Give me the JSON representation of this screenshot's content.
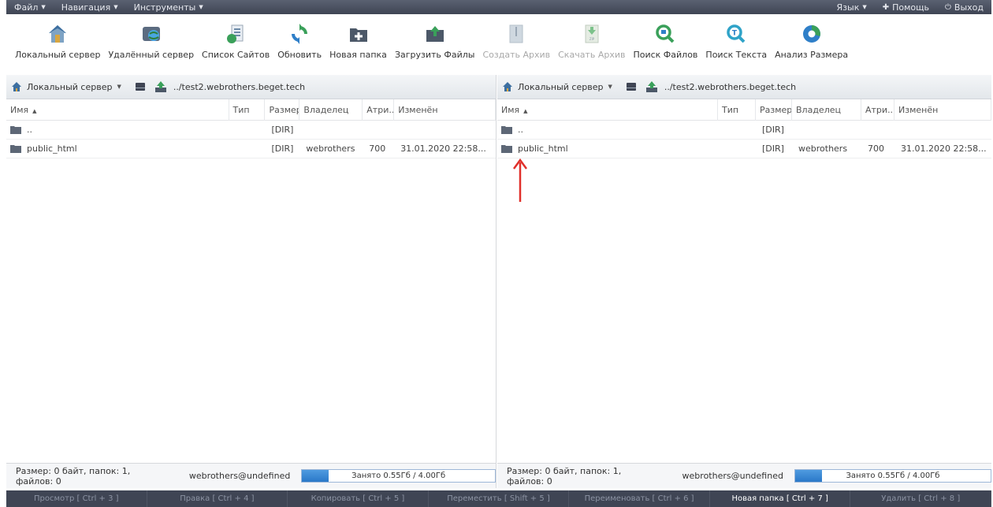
{
  "menubar": {
    "file": "Файл",
    "navigation": "Навигация",
    "tools": "Инструменты",
    "language": "Язык",
    "help": "Помощь",
    "logout": "Выход"
  },
  "toolbar": {
    "items": [
      {
        "label": "Локальный сервер",
        "icon": "home-icon",
        "enabled": true
      },
      {
        "label": "Удалённый сервер",
        "icon": "remote-server-icon",
        "enabled": true
      },
      {
        "label": "Список Сайтов",
        "icon": "site-list-icon",
        "enabled": true
      },
      {
        "label": "Обновить",
        "icon": "refresh-icon",
        "enabled": true
      },
      {
        "label": "Новая папка",
        "icon": "new-folder-icon",
        "enabled": true
      },
      {
        "label": "Загрузить Файлы",
        "icon": "upload-icon",
        "enabled": true
      },
      {
        "label": "Создать Архив",
        "icon": "archive-icon",
        "enabled": false
      },
      {
        "label": "Скачать Архив",
        "icon": "download-zip-icon",
        "enabled": false
      },
      {
        "label": "Поиск Файлов",
        "icon": "search-files-icon",
        "enabled": true
      },
      {
        "label": "Поиск Текста",
        "icon": "search-text-icon",
        "enabled": true
      },
      {
        "label": "Анализ Размера",
        "icon": "size-analysis-icon",
        "enabled": true
      }
    ]
  },
  "columns": {
    "name": "Имя",
    "type": "Тип",
    "size": "Размер",
    "owner": "Владелец",
    "attr": "Атри...",
    "modified": "Изменён"
  },
  "left_panel": {
    "server": "Локальный сервер",
    "path": "../test2.webrothers.beget.tech",
    "rows": [
      {
        "name": "..",
        "size": "[DIR]",
        "owner": "",
        "attr": "",
        "modified": ""
      },
      {
        "name": "public_html",
        "size": "[DIR]",
        "owner": "webrothers",
        "attr": "700",
        "modified": "31.01.2020 22:58..."
      }
    ],
    "status": "Размер: 0 байт, папок: 1, файлов: 0",
    "user": "webrothers@undefined",
    "quota_text": "Занято 0.55Гб / 4.00Гб",
    "quota_fraction": 0.1375
  },
  "right_panel": {
    "server": "Локальный сервер",
    "path": "../test2.webrothers.beget.tech",
    "rows": [
      {
        "name": "..",
        "size": "[DIR]",
        "owner": "",
        "attr": "",
        "modified": ""
      },
      {
        "name": "public_html",
        "size": "[DIR]",
        "owner": "webrothers",
        "attr": "700",
        "modified": "31.01.2020 22:58..."
      }
    ],
    "status": "Размер: 0 байт, папок: 1, файлов: 0",
    "user": "webrothers@undefined",
    "quota_text": "Занято 0.55Гб / 4.00Гб",
    "quota_fraction": 0.1375
  },
  "fnbar": [
    {
      "label": "Просмотр [ Ctrl + 3 ]",
      "active": false
    },
    {
      "label": "Правка [ Ctrl + 4 ]",
      "active": false
    },
    {
      "label": "Копировать [ Ctrl + 5 ]",
      "active": false
    },
    {
      "label": "Переместить [ Shift + 5 ]",
      "active": false
    },
    {
      "label": "Переименовать [ Ctrl + 6 ]",
      "active": false
    },
    {
      "label": "Новая папка [ Ctrl + 7 ]",
      "active": true
    },
    {
      "label": "Удалить [ Ctrl + 8 ]",
      "active": false
    }
  ],
  "colors": {
    "accent": "#2a78c8",
    "menubar": "#3f4554",
    "annotation_arrow": "#e0302b"
  }
}
